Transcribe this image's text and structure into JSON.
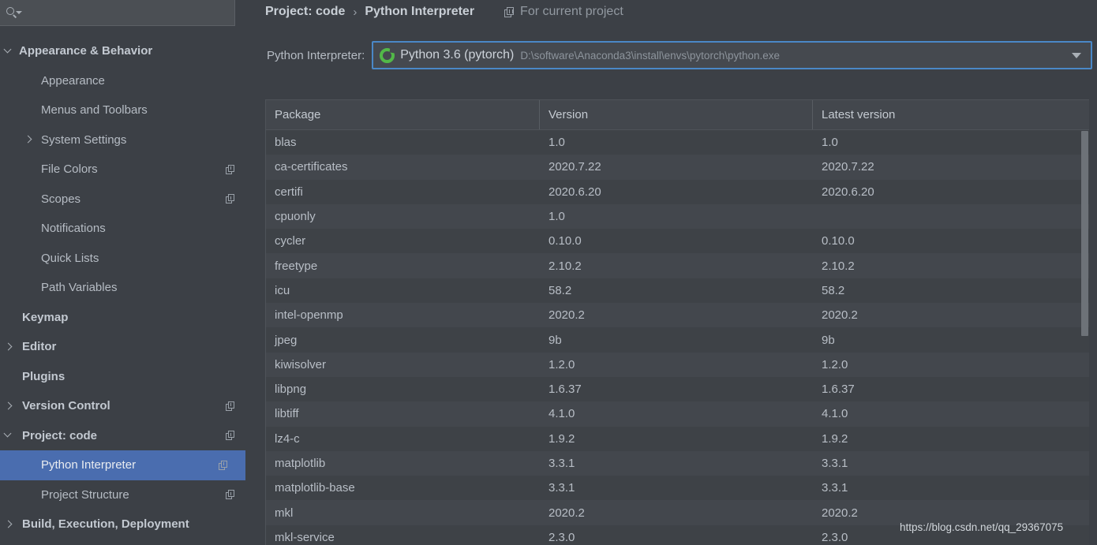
{
  "search": {
    "value": "",
    "placeholder": "",
    "icon": "search-icon"
  },
  "sidebar": {
    "items": [
      {
        "label": "Appearance & Behavior",
        "indent": 24,
        "bold": true,
        "arrow": "down",
        "copy": false,
        "selected": false
      },
      {
        "label": "Appearance",
        "indent": 52,
        "bold": false,
        "arrow": "none",
        "copy": false,
        "selected": false
      },
      {
        "label": "Menus and Toolbars",
        "indent": 52,
        "bold": false,
        "arrow": "none",
        "copy": false,
        "selected": false
      },
      {
        "label": "System Settings",
        "indent": 52,
        "bold": false,
        "arrow": "right",
        "arrowLeft": 31,
        "copy": false,
        "selected": false
      },
      {
        "label": "File Colors",
        "indent": 52,
        "bold": false,
        "arrow": "none",
        "copy": true,
        "selected": false
      },
      {
        "label": "Scopes",
        "indent": 52,
        "bold": false,
        "arrow": "none",
        "copy": true,
        "selected": false
      },
      {
        "label": "Notifications",
        "indent": 52,
        "bold": false,
        "arrow": "none",
        "copy": false,
        "selected": false
      },
      {
        "label": "Quick Lists",
        "indent": 52,
        "bold": false,
        "arrow": "none",
        "copy": false,
        "selected": false
      },
      {
        "label": "Path Variables",
        "indent": 52,
        "bold": false,
        "arrow": "none",
        "copy": false,
        "selected": false
      },
      {
        "label": "Keymap",
        "indent": 28,
        "bold": true,
        "arrow": "none",
        "copy": false,
        "selected": false
      },
      {
        "label": "Editor",
        "indent": 28,
        "bold": true,
        "arrow": "down",
        "arrowRotate": "right",
        "copy": false,
        "selected": false
      },
      {
        "label": "Plugins",
        "indent": 28,
        "bold": true,
        "arrow": "none",
        "copy": false,
        "selected": false
      },
      {
        "label": "Version Control",
        "indent": 28,
        "bold": true,
        "arrow": "right",
        "copy": true,
        "selected": false
      },
      {
        "label": "Project: code",
        "indent": 28,
        "bold": true,
        "arrow": "down",
        "copy": true,
        "selected": false
      },
      {
        "label": "Python Interpreter",
        "indent": 52,
        "bold": false,
        "arrow": "none",
        "copy": true,
        "selected": true
      },
      {
        "label": "Project Structure",
        "indent": 52,
        "bold": false,
        "arrow": "none",
        "copy": true,
        "selected": false
      },
      {
        "label": "Build, Execution, Deployment",
        "indent": 28,
        "bold": true,
        "arrow": "right",
        "copy": false,
        "selected": false
      }
    ]
  },
  "header": {
    "crumb1": "Project: code",
    "separator": "›",
    "crumb2": "Python Interpreter",
    "for_current_project": "For current project",
    "for_project_icon": "copy-icon"
  },
  "interpreter": {
    "label": "Python Interpreter:",
    "icon": "conda-env-icon",
    "name": "Python 3.6 (pytorch)",
    "path": "D:\\software\\Anaconda3\\install\\envs\\pytorch\\python.exe",
    "dropdown_icon": "chevron-down-icon"
  },
  "packages_table": {
    "columns": [
      "Package",
      "Version",
      "Latest version"
    ],
    "rows": [
      {
        "package": "blas",
        "version": "1.0",
        "latest": "1.0"
      },
      {
        "package": "ca-certificates",
        "version": "2020.7.22",
        "latest": "2020.7.22"
      },
      {
        "package": "certifi",
        "version": "2020.6.20",
        "latest": "2020.6.20"
      },
      {
        "package": "cpuonly",
        "version": "1.0",
        "latest": ""
      },
      {
        "package": "cycler",
        "version": "0.10.0",
        "latest": "0.10.0"
      },
      {
        "package": "freetype",
        "version": "2.10.2",
        "latest": "2.10.2"
      },
      {
        "package": "icu",
        "version": "58.2",
        "latest": "58.2"
      },
      {
        "package": "intel-openmp",
        "version": "2020.2",
        "latest": "2020.2"
      },
      {
        "package": "jpeg",
        "version": "9b",
        "latest": "9b"
      },
      {
        "package": "kiwisolver",
        "version": "1.2.0",
        "latest": "1.2.0"
      },
      {
        "package": "libpng",
        "version": "1.6.37",
        "latest": "1.6.37"
      },
      {
        "package": "libtiff",
        "version": "4.1.0",
        "latest": "4.1.0"
      },
      {
        "package": "lz4-c",
        "version": "1.9.2",
        "latest": "1.9.2"
      },
      {
        "package": "matplotlib",
        "version": "3.3.1",
        "latest": "3.3.1"
      },
      {
        "package": "matplotlib-base",
        "version": "3.3.1",
        "latest": "3.3.1"
      },
      {
        "package": "mkl",
        "version": "2020.2",
        "latest": "2020.2"
      },
      {
        "package": "mkl-service",
        "version": "2.3.0",
        "latest": "2.3.0"
      }
    ]
  },
  "watermark": {
    "text": "https://blog.csdn.net/qq_29367075"
  },
  "colors": {
    "background": "#3c4046",
    "selection_blue": "#4a6daf",
    "focus_border": "#4a88c7",
    "conda_green": "#52b848",
    "row_even": "#43474d",
    "row_odd": "#3e4247"
  }
}
